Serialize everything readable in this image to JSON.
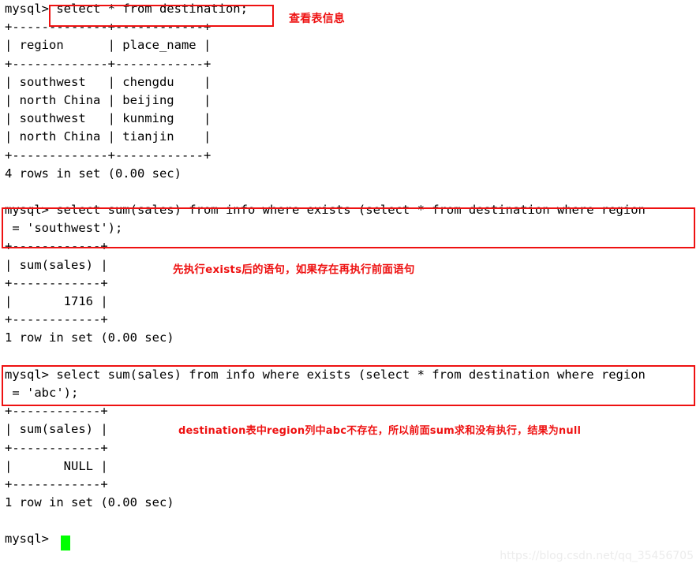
{
  "terminal": {
    "prompt": "mysql>",
    "lines": [
      "mysql> select * from destination;",
      "+-------------+------------+",
      "| region      | place_name |",
      "+-------------+------------+",
      "| southwest   | chengdu    |",
      "| north China | beijing    |",
      "| southwest   | kunming    |",
      "| north China | tianjin    |",
      "+-------------+------------+",
      "4 rows in set (0.00 sec)",
      "",
      "mysql> select sum(sales) from info where exists (select * from destination where region",
      " = 'southwest');",
      "+------------+",
      "| sum(sales) |",
      "+------------+",
      "|       1716 |",
      "+------------+",
      "1 row in set (0.00 sec)",
      "",
      "mysql> select sum(sales) from info where exists (select * from destination where region",
      " = 'abc');",
      "+------------+",
      "| sum(sales) |",
      "+------------+",
      "|       NULL |",
      "+------------+",
      "1 row in set (0.00 sec)",
      "",
      "mysql> "
    ],
    "query_1": {
      "command": "select * from destination;",
      "result_table": {
        "columns": [
          "region",
          "place_name"
        ],
        "rows": [
          [
            "southwest",
            "chengdu"
          ],
          [
            "north China",
            "beijing"
          ],
          [
            "southwest",
            "kunming"
          ],
          [
            "north China",
            "tianjin"
          ]
        ],
        "status": "4 rows in set (0.00 sec)"
      }
    },
    "query_2": {
      "command_line_1": "mysql> select sum(sales) from info where exists (select * from destination where region",
      "command_line_2": " = 'southwest');",
      "result_table": {
        "columns": [
          "sum(sales)"
        ],
        "rows": [
          [
            "1716"
          ]
        ],
        "status": "1 row in set (0.00 sec)"
      }
    },
    "query_3": {
      "command_line_1": "mysql> select sum(sales) from info where exists (select * from destination where region",
      "command_line_2": " = 'abc');",
      "result_table": {
        "columns": [
          "sum(sales)"
        ],
        "rows": [
          [
            "NULL"
          ]
        ],
        "status": "1 row in set (0.00 sec)"
      }
    }
  },
  "annotations": {
    "top": "查看表信息",
    "middle": "先执行exists后的语句，如果存在再执行前面语句",
    "bottom": "destination表中region列中abc不存在，所以前面sum求和没有执行，结果为null"
  },
  "watermark": "https://blog.csdn.net/qq_35456705",
  "colors": {
    "annotation_red": "#ee1111",
    "cursor_green": "#00ff00",
    "terminal_text": "#000000",
    "terminal_bg": "#ffffff"
  }
}
